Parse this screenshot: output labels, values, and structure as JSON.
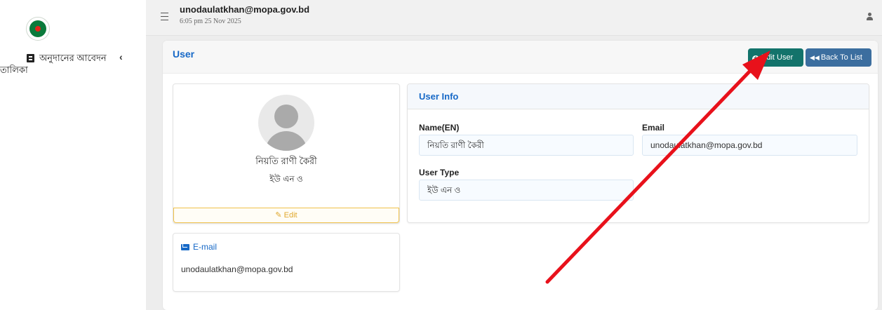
{
  "sidebar": {
    "menu_label": "অনুদানের আবেদন তালিকা"
  },
  "header": {
    "email": "unodaulatkhan@mopa.gov.bd",
    "datetime": "6:05 pm 25 Nov 2025"
  },
  "card": {
    "title": "User",
    "edit_user_label": "Edit User",
    "back_label": "Back To List"
  },
  "profile": {
    "name": "নিয়তি রাণী কৈরী",
    "user_type": "ইউ এন ও",
    "edit_label": "Edit"
  },
  "email_card": {
    "title": "E-mail",
    "value": "unodaulatkhan@mopa.gov.bd"
  },
  "user_info": {
    "title": "User Info",
    "name_label": "Name(EN)",
    "name_value": "নিয়তি রাণী কৈরী",
    "email_label": "Email",
    "email_value": "unodaulatkhan@mopa.gov.bd",
    "type_label": "User Type",
    "type_value": "ইউ এন ও"
  },
  "colors": {
    "accent_blue": "#1769c7",
    "edit_button": "#13736b",
    "back_button": "#3c6e9f",
    "arrow": "#e8111b"
  }
}
